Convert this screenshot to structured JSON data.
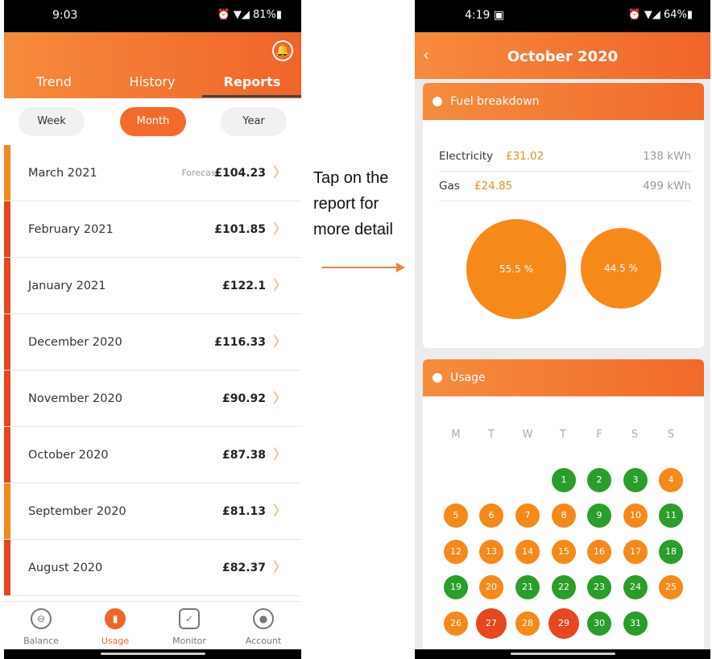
{
  "left": {
    "status": {
      "time": "9:03",
      "icons": "⏰ ▼◢ 81%▮"
    },
    "tabs": [
      "Trend",
      "History",
      "Reports"
    ],
    "periods": [
      "Week",
      "Month",
      "Year"
    ],
    "rows": [
      {
        "month": "March 2021",
        "forecast": "Forecast",
        "amount": "£104.23"
      },
      {
        "month": "February 2021",
        "forecast": "",
        "amount": "£101.85"
      },
      {
        "month": "January 2021",
        "forecast": "",
        "amount": "£122.1"
      },
      {
        "month": "December 2020",
        "forecast": "",
        "amount": "£116.33"
      },
      {
        "month": "November 2020",
        "forecast": "",
        "amount": "£90.92"
      },
      {
        "month": "October 2020",
        "forecast": "",
        "amount": "£87.38"
      },
      {
        "month": "September 2020",
        "forecast": "",
        "amount": "£81.13"
      },
      {
        "month": "August 2020",
        "forecast": "",
        "amount": "£82.37"
      }
    ],
    "nav": [
      "Balance",
      "Usage",
      "Monitor",
      "Account"
    ]
  },
  "annotation": {
    "lines": [
      "Tap on the",
      "report for",
      "more detail"
    ]
  },
  "right": {
    "status": {
      "time": "4:19 ▣",
      "icons": "⏰ ▼◢ 64%▮"
    },
    "title": "October 2020",
    "fuel": {
      "heading": "Fuel breakdown",
      "electricity": {
        "label": "Electricity",
        "cost": "£31.02",
        "kwh": "138 kWh"
      },
      "gas": {
        "label": "Gas",
        "cost": "£24.85",
        "kwh": "499 kWh"
      },
      "pct_electricity": "55.5 %",
      "pct_gas": "44.5 %"
    },
    "usage": {
      "heading": "Usage",
      "weekdays": [
        "M",
        "T",
        "W",
        "T",
        "F",
        "S",
        "S"
      ]
    }
  },
  "colors": {
    "orange": "#f5891a",
    "green": "#2a9d2a",
    "red": "#e8461e",
    "accent": "#f0642a"
  }
}
